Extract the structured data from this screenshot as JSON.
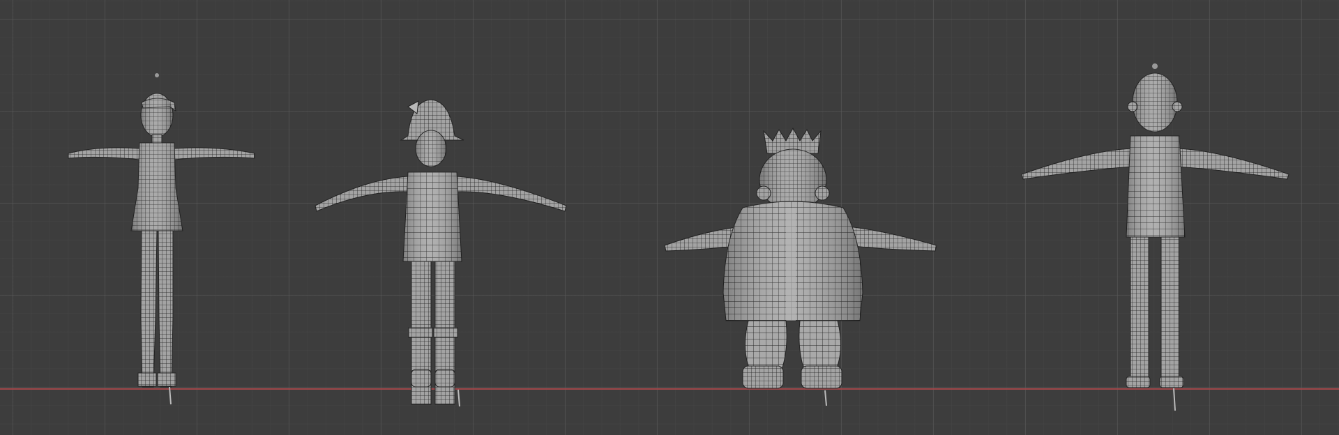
{
  "viewport": {
    "background": "#3d3d3d",
    "x_axis_color": "#a0474a",
    "mesh_fill": "#a9a9a9",
    "mesh_wire": "#1a1a1a"
  },
  "objects": [
    {
      "name": "girl-character-mesh",
      "description_icon": "mesh-icon"
    },
    {
      "name": "hunter-character-mesh",
      "description_icon": "mesh-icon"
    },
    {
      "name": "king-character-mesh",
      "description_icon": "mesh-icon"
    },
    {
      "name": "bald-man-character-mesh",
      "description_icon": "mesh-icon"
    }
  ]
}
